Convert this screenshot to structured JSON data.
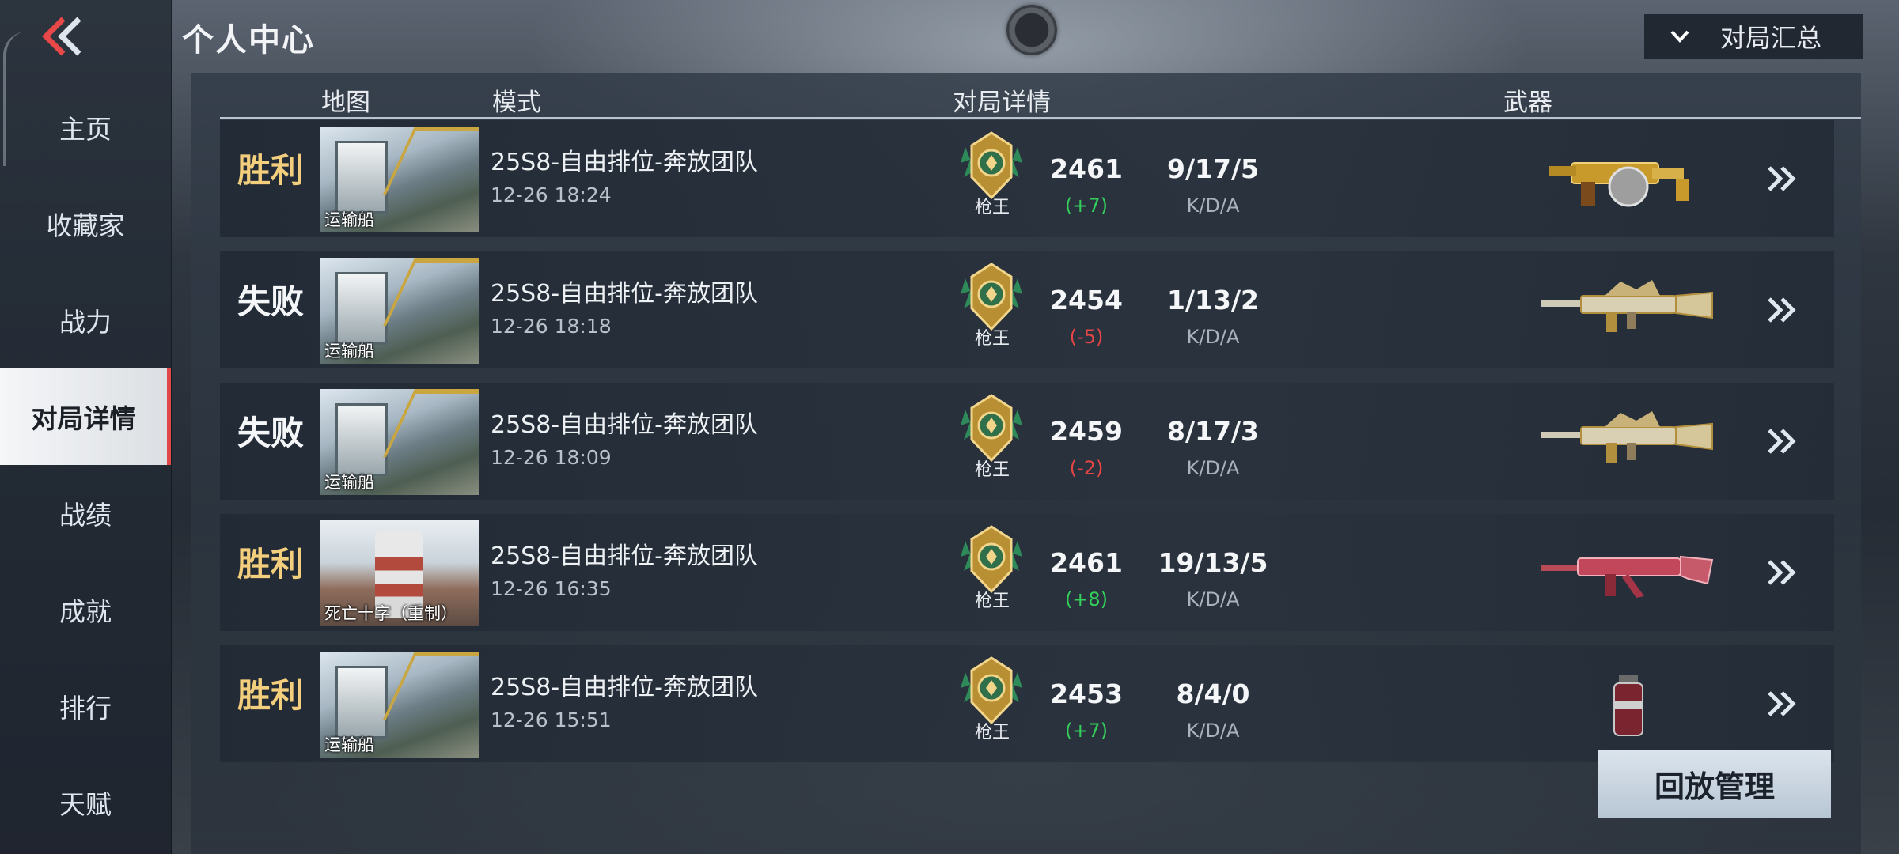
{
  "header": {
    "title": "个人中心",
    "summary_label": "对局汇总"
  },
  "sidebar": {
    "items": [
      {
        "label": "主页"
      },
      {
        "label": "收藏家"
      },
      {
        "label": "战力"
      },
      {
        "label": "对局详情",
        "active": true
      },
      {
        "label": "战绩"
      },
      {
        "label": "成就"
      },
      {
        "label": "排行"
      },
      {
        "label": "天赋"
      }
    ]
  },
  "table": {
    "columns": {
      "map": "地图",
      "mode": "模式",
      "details": "对局详情",
      "weapon": "武器"
    },
    "kda_label": "K/D/A",
    "rows": [
      {
        "result": "胜利",
        "map": "运输船",
        "mode": "25S8-自由排位-奔放团队",
        "time": "12-26 18:24",
        "rank": "枪王",
        "score": "2461",
        "delta": "(+7)",
        "kda": "9/17/5",
        "weapon_icon": "gold-drum-smg-icon"
      },
      {
        "result": "失败",
        "map": "运输船",
        "mode": "25S8-自由排位-奔放团队",
        "time": "12-26 18:18",
        "rank": "枪王",
        "score": "2454",
        "delta": "(-5)",
        "kda": "1/13/2",
        "weapon_icon": "gold-dragon-rifle-icon"
      },
      {
        "result": "失败",
        "map": "运输船",
        "mode": "25S8-自由排位-奔放团队",
        "time": "12-26 18:09",
        "rank": "枪王",
        "score": "2459",
        "delta": "(-2)",
        "kda": "8/17/3",
        "weapon_icon": "gold-dragon-rifle-icon"
      },
      {
        "result": "胜利",
        "map": "死亡十字（重制）",
        "mode": "25S8-自由排位-奔放团队",
        "time": "12-26 16:35",
        "rank": "枪王",
        "score": "2461",
        "delta": "(+8)",
        "kda": "19/13/5",
        "weapon_icon": "red-rifle-icon"
      },
      {
        "result": "胜利",
        "map": "运输船",
        "mode": "25S8-自由排位-奔放团队",
        "time": "12-26 15:51",
        "rank": "枪王",
        "score": "2453",
        "delta": "(+7)",
        "kda": "8/4/0",
        "weapon_icon": "grenade-icon"
      }
    ]
  },
  "replay_button": "回放管理",
  "colors": {
    "win": "#f3cf7d",
    "lose": "#f4f6f8",
    "delta_up": "#33d05a",
    "delta_down": "#e64646",
    "active_tab_accent": "#e04848"
  }
}
